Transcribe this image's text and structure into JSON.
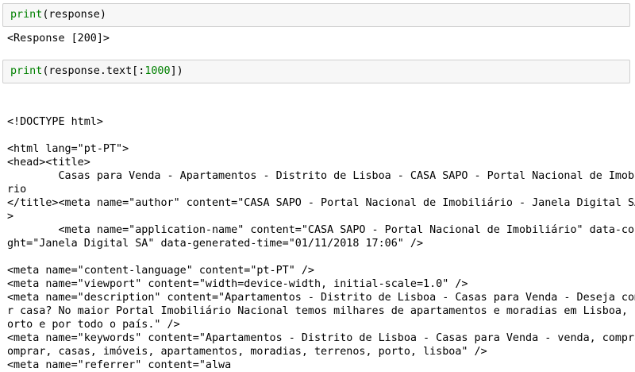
{
  "cells": [
    {
      "input": {
        "func": "print",
        "open": "(",
        "arg": "response",
        "close": ")"
      },
      "output": "<Response [200]>"
    },
    {
      "input": {
        "func": "print",
        "open": "(",
        "arg_pre": "response.text[:",
        "num": "1000",
        "arg_post": "])"
      },
      "output_lines": [
        "",
        "",
        "<!DOCTYPE html>",
        "",
        "<html lang=\"pt-PT\">",
        "<head><title>",
        "        Casas para Venda - Apartamentos - Distrito de Lisboa - CASA SAPO - Portal Nacional de Imobiliá",
        "rio",
        "</title><meta name=\"author\" content=\"CASA SAPO - Portal Nacional de Imobiliário - Janela Digital SA\" /",
        ">",
        "        <meta name=\"application-name\" content=\"CASA SAPO - Portal Nacional de Imobiliário\" data-copyri",
        "ght=\"Janela Digital SA\" data-generated-time=\"01/11/2018 17:06\" />",
        "",
        "<meta name=\"content-language\" content=\"pt-PT\" />",
        "<meta name=\"viewport\" content=\"width=device-width, initial-scale=1.0\" />",
        "<meta name=\"description\" content=\"Apartamentos - Distrito de Lisboa - Casas para Venda - Deseja compra",
        "r casa? No maior Portal Imobiliário Nacional temos milhares de apartamentos e moradias em Lisboa, no P",
        "orto e por todo o país.\" />",
        "<meta name=\"keywords\" content=\"Apartamentos - Distrito de Lisboa - Casas para Venda - venda, compra, c",
        "omprar, casas, imóveis, apartamentos, moradias, terrenos, porto, lisboa\" />",
        "<meta name=\"referrer\" content=\"alwa"
      ]
    }
  ]
}
